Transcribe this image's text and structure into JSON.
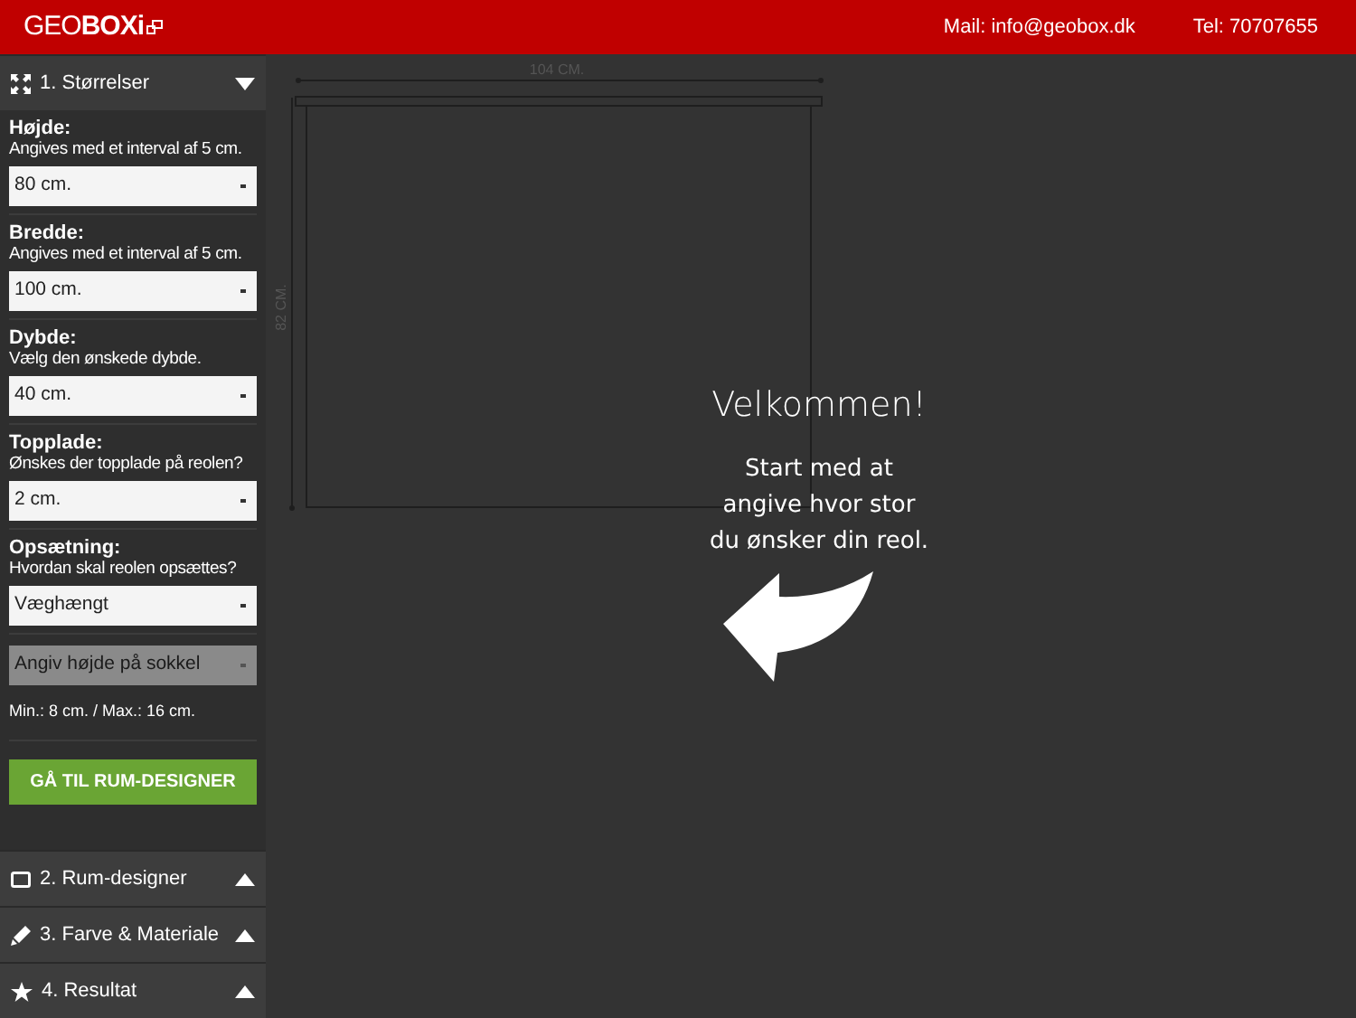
{
  "header": {
    "logo": "GEO**BOXi**",
    "mail": "Mail: info@geobox.dk",
    "tel": "Tel: 70707655"
  },
  "sections": [
    {
      "label": "1. Størrelser",
      "expanded": true
    },
    {
      "label": "2. Rum-designer",
      "expanded": false
    },
    {
      "label": "3. Farve & Materiale",
      "expanded": false
    },
    {
      "label": "4. Resultat",
      "expanded": false
    }
  ],
  "fields": [
    {
      "label": "Højde:",
      "hint": "Angives med et interval af 5 cm.",
      "value": "80 cm.",
      "disabled": false
    },
    {
      "label": "Bredde:",
      "hint": "Angives med et interval af 5 cm.",
      "value": "100 cm.",
      "disabled": false
    },
    {
      "label": "Dybde:",
      "hint": "Vælg den ønskede dybde.",
      "value": "40 cm.",
      "disabled": false
    },
    {
      "label": "Topplade:",
      "hint": "Ønskes der topplade på reolen?",
      "value": "2 cm.",
      "disabled": false
    },
    {
      "label": "Opsætning:",
      "hint": "Hvordan skal reolen opsættes?",
      "value": "Væghængt",
      "disabled": false
    },
    {
      "value": "Angiv højde på sokkel",
      "disabled": true
    }
  ],
  "note": "Min.: 8 cm. / Max.: 16 cm.",
  "button": "GÅ TIL RUM-DESIGNER",
  "canvas": {
    "width_label": "104 CM.",
    "height_label": "82 CM."
  },
  "welcome": {
    "title": "Velkommen!",
    "lines": [
      "Start med at",
      "angive hvor stor",
      "du ønsker din reol."
    ]
  }
}
